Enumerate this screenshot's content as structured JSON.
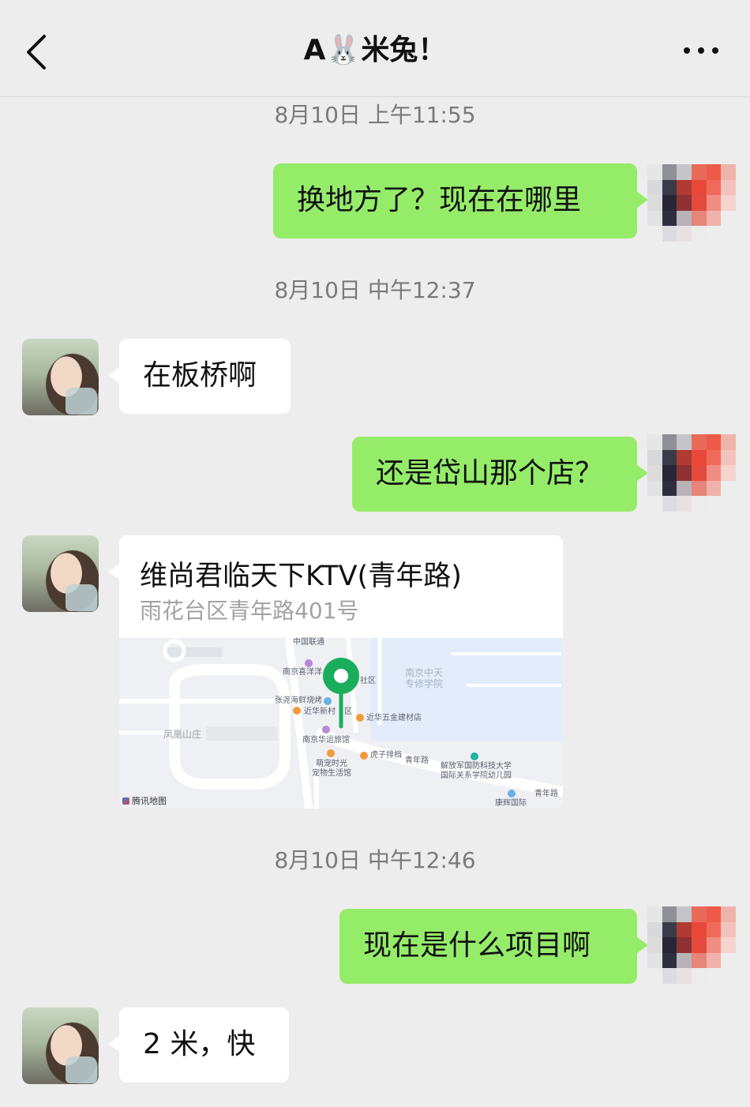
{
  "header": {
    "title": "A🐰米兔！",
    "back_icon": "chevron-left-icon",
    "more_icon": "ellipsis-icon"
  },
  "colors": {
    "background": "#ededed",
    "outgoing_bubble": "#95ec69",
    "incoming_bubble": "#ffffff",
    "map_pin": "#1aad5b"
  },
  "messages": {
    "t1": "8月10日 上午11:55",
    "m1": "换地方了？现在在哪里",
    "t2": "8月10日 中午12:37",
    "m2": "在板桥啊",
    "m3": "还是岱山那个店？",
    "location": {
      "name": "维尚君临天下KTV(青年路)",
      "address": "雨花台区青年路401号",
      "map_labels": {
        "l1": "中国联通",
        "l2": "南京喜洋洋",
        "l3": "南京中天",
        "l4": "专修学院",
        "l5": "张尧海鲜烧烤",
        "l6": "近华新村",
        "l7": "区",
        "l8": "社区",
        "l9": "近华五金建材店",
        "l10": "凤凰山庄",
        "l11": "南京华运旅馆",
        "l12": "虎子排档",
        "l13": "青年路",
        "l14": "萌宠时光",
        "l15": "宠物生活馆",
        "l16": "解放军国防科技大学",
        "l17": "国际关系学院幼儿园",
        "l18": "青年路",
        "l19": "康辉国际",
        "brand": "腾讯地图"
      }
    },
    "t3": "8月10日 中午12:46",
    "m4": "现在是什么项目啊",
    "m5": "2 米，快"
  }
}
